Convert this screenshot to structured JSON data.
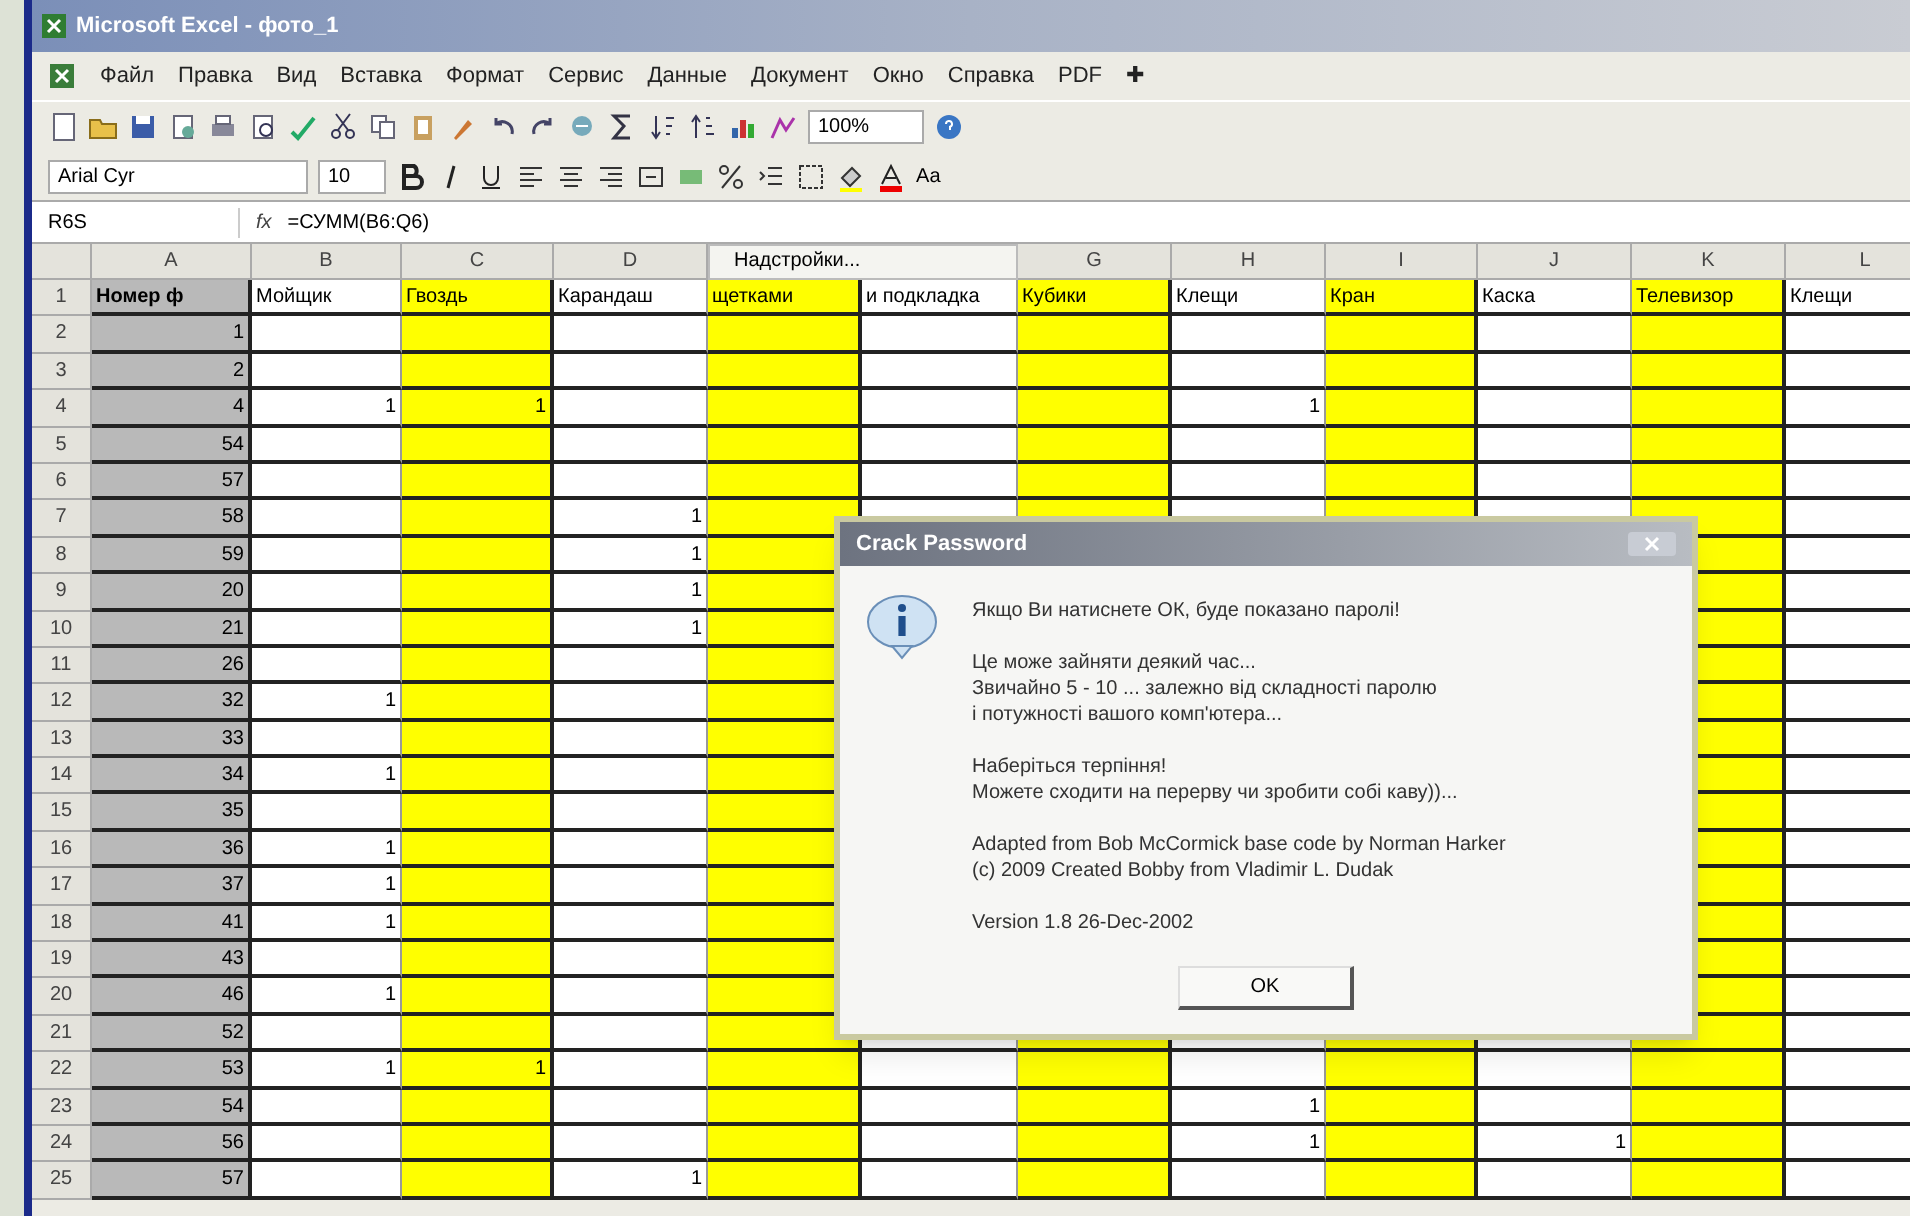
{
  "window": {
    "title": "Microsoft Excel - фото_1"
  },
  "menu": [
    "Файл",
    "Правка",
    "Вид",
    "Вставка",
    "Формат",
    "Сервис",
    "Данные",
    "Документ",
    "Окно",
    "Справка",
    "PDF",
    "✚"
  ],
  "format_bar": {
    "font": "Arial Cyr",
    "size": "10",
    "zoom": "100%",
    "right_text": "Аа"
  },
  "formula_bar": {
    "name_box": "R6S",
    "fx": "fx",
    "formula": "=СУММ(B6:Q6)"
  },
  "floating_toolbar": {
    "title": "Надстройки..."
  },
  "columns": [
    {
      "letter": "A",
      "header": "Номер ф",
      "color": "#b9b9b9"
    },
    {
      "letter": "B",
      "header": "Мойщик",
      "color": "#ffffff"
    },
    {
      "letter": "C",
      "header": "Гвоздь",
      "color": "#ffff00"
    },
    {
      "letter": "D",
      "header": "Карандаш",
      "color": "#ffffff"
    },
    {
      "header": "щетками",
      "color": "#ffff00"
    },
    {
      "header": "и подкладка",
      "color": "#ffffff"
    },
    {
      "letter": "G",
      "header": "Кубики",
      "color": "#ffff00"
    },
    {
      "letter": "H",
      "header": "Клещи",
      "color": "#ffffff"
    },
    {
      "letter": "I",
      "header": "Кран",
      "color": "#ffff00"
    },
    {
      "letter": "J",
      "header": "Каска",
      "color": "#ffffff"
    },
    {
      "letter": "K",
      "header": "Телевизор",
      "color": "#ffff00"
    },
    {
      "letter": "L",
      "header": "Клещи",
      "color": "#ffffff"
    }
  ],
  "rows": [
    {
      "number": "1"
    },
    {
      "number": "2",
      "cells": {
        "A": "1"
      }
    },
    {
      "number": "3",
      "cells": {
        "A": "2"
      }
    },
    {
      "number": "4",
      "cells": {
        "A": "4",
        "B": "1",
        "C": "1",
        "H": "1"
      }
    },
    {
      "number": "5",
      "cells": {
        "A": "54"
      }
    },
    {
      "number": "6",
      "cells": {
        "A": "57"
      }
    },
    {
      "number": "7",
      "cells": {
        "A": "58",
        "D": "1"
      }
    },
    {
      "number": "8",
      "cells": {
        "A": "59",
        "D": "1"
      }
    },
    {
      "number": "9",
      "cells": {
        "A": "20",
        "D": "1"
      }
    },
    {
      "number": "10",
      "cells": {
        "A": "21",
        "D": "1"
      }
    },
    {
      "number": "11",
      "cells": {
        "A": "26"
      }
    },
    {
      "number": "12",
      "cells": {
        "A": "32",
        "B": "1"
      }
    },
    {
      "number": "13",
      "cells": {
        "A": "33"
      }
    },
    {
      "number": "14",
      "cells": {
        "A": "34",
        "B": "1"
      }
    },
    {
      "number": "15",
      "cells": {
        "A": "35"
      }
    },
    {
      "number": "16",
      "cells": {
        "A": "36",
        "B": "1"
      }
    },
    {
      "number": "17",
      "cells": {
        "A": "37",
        "B": "1"
      }
    },
    {
      "number": "18",
      "cells": {
        "A": "41",
        "B": "1"
      }
    },
    {
      "number": "19",
      "cells": {
        "A": "43"
      }
    },
    {
      "number": "20",
      "cells": {
        "A": "46",
        "B": "1"
      }
    },
    {
      "number": "21",
      "cells": {
        "A": "52"
      }
    },
    {
      "number": "22",
      "cells": {
        "A": "53",
        "B": "1",
        "C": "1"
      }
    },
    {
      "number": "23",
      "cells": {
        "A": "54",
        "H": "1"
      }
    },
    {
      "number": "24",
      "cells": {
        "A": "56",
        "H": "1",
        "J": "1"
      }
    },
    {
      "number": "25",
      "cells": {
        "A": "57",
        "D": "1"
      }
    }
  ],
  "dialog": {
    "title": "Crack Password",
    "paragraphs": [
      [
        "Якщо Ви натиснете ОК, буде показано паролі!"
      ],
      [
        "Це може зайняти деякий час...",
        "Звичайно 5 - 10 ... залежно від складності паролю",
        "і потужності вашого комп'ютера..."
      ],
      [
        "Наберіться терпіння!",
        "Можете сходити на перерву чи зробити собі каву))..."
      ],
      [
        "Adapted from Bob McCormick base code by Norman Harker",
        "(c) 2009 Created Bobby from Vladimir L. Dudak"
      ],
      [
        "Version 1.8 26-Dec-2002"
      ]
    ],
    "button": "OK"
  }
}
